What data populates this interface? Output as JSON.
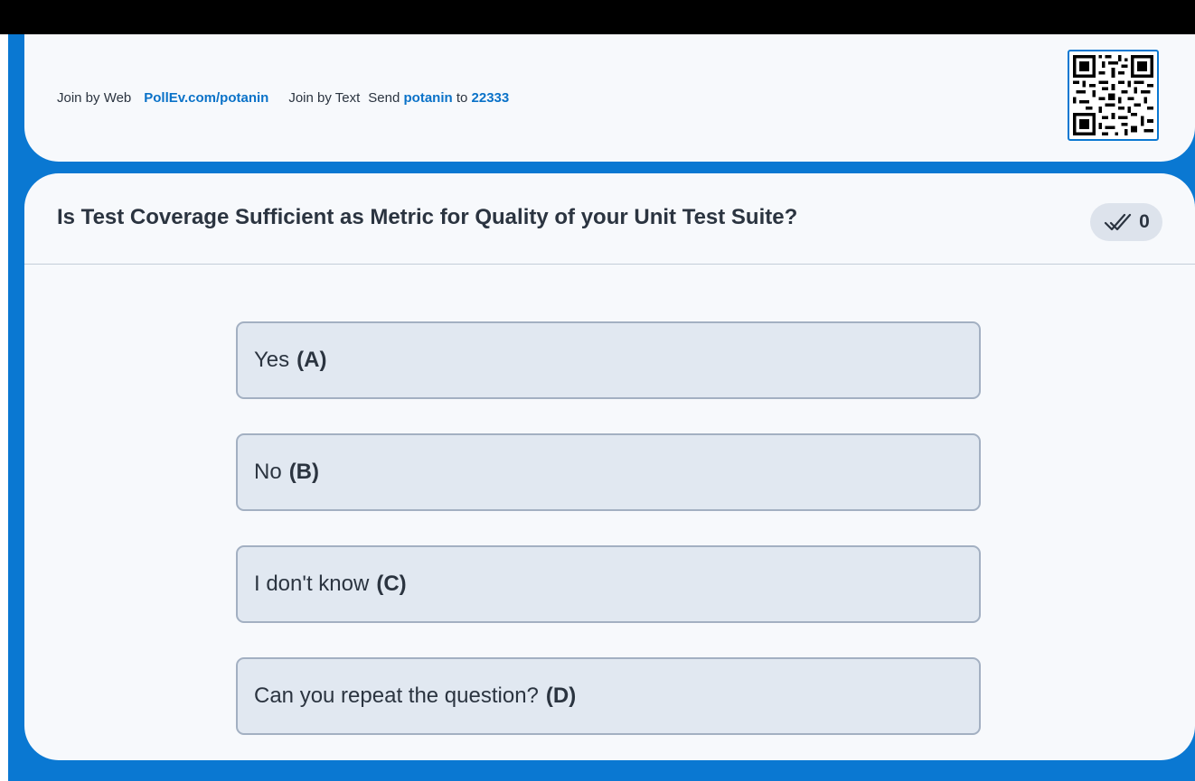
{
  "join": {
    "web_label": "Join by Web",
    "web_url": "PollEv.com/potanin",
    "text_label": "Join by Text",
    "send_label": "Send",
    "keyword": "potanin",
    "to_label": "to",
    "number": "22333",
    "qr_icon": "qr-code-icon"
  },
  "poll": {
    "question": "Is Test Coverage Sufficient as Metric for Quality of your Unit Test Suite?",
    "response_icon": "double-check-icon",
    "response_count": "0",
    "options": [
      {
        "text": "Yes",
        "key": "(A)"
      },
      {
        "text": "No",
        "key": "(B)"
      },
      {
        "text": "I don't know",
        "key": "(C)"
      },
      {
        "text": "Can you repeat the question?",
        "key": "(D)"
      }
    ]
  },
  "colors": {
    "frame": "#0a78d2",
    "card": "#f7f9fc",
    "link": "#0a72c8",
    "option_bg": "#e1e8f1",
    "option_border": "#a3b0c2"
  }
}
